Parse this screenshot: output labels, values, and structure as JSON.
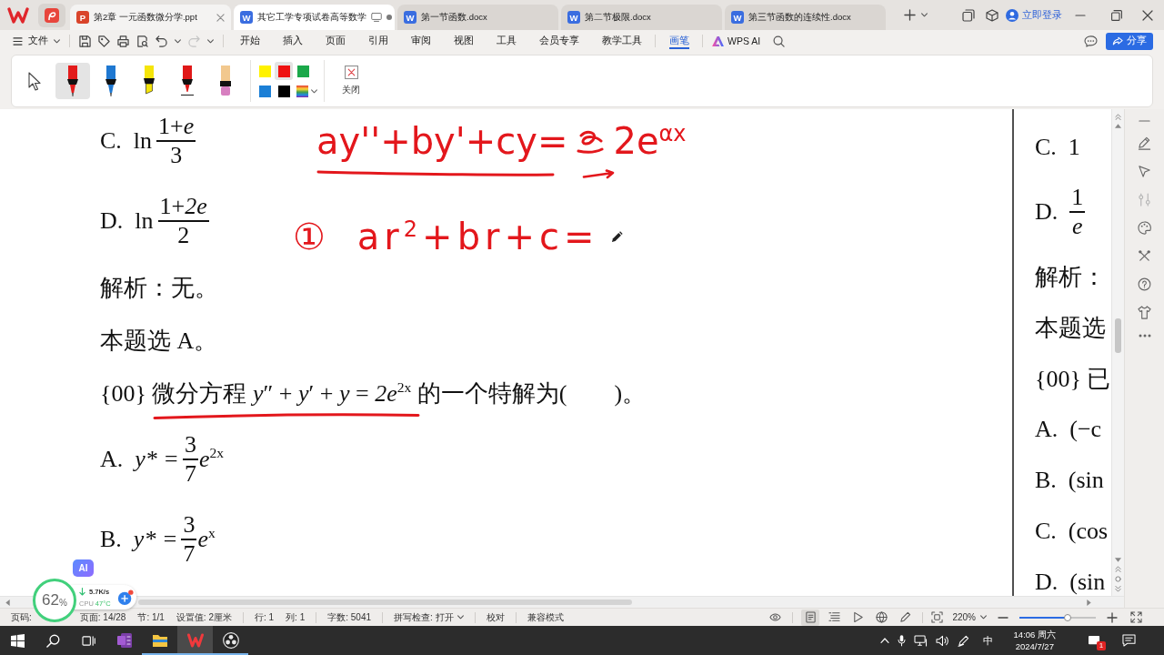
{
  "tab_bar": {
    "tabs": [
      {
        "kind": "ppt",
        "icon_text": "P",
        "title": "第2章 一元函数微分学.ppt",
        "selected": false,
        "hovered": true,
        "modified": false
      },
      {
        "kind": "doc",
        "icon_text": "W",
        "title": "其它工学专项试卷高等数学",
        "selected": true,
        "hovered": false,
        "modified": true
      },
      {
        "kind": "doc",
        "icon_text": "W",
        "title": "第一节函数.docx",
        "selected": false,
        "hovered": false,
        "modified": false
      },
      {
        "kind": "doc",
        "icon_text": "W",
        "title": "第二节极限.docx",
        "selected": false,
        "hovered": false,
        "modified": false
      },
      {
        "kind": "doc",
        "icon_text": "W",
        "title": "第三节函数的连续性.docx",
        "selected": false,
        "hovered": false,
        "modified": false
      }
    ],
    "login": "立即登录"
  },
  "menu_bar": {
    "file_menu": "文件",
    "redo": {
      "disabled": true
    },
    "tab_groups": [
      [
        {
          "kind": "text",
          "label": "开始",
          "selected": false
        },
        {
          "kind": "text",
          "label": "插入",
          "selected": false
        },
        {
          "kind": "text",
          "label": "页面",
          "selected": false
        },
        {
          "kind": "text",
          "label": "引用",
          "selected": false
        },
        {
          "kind": "text",
          "label": "审阅",
          "selected": false
        },
        {
          "kind": "text",
          "label": "视图",
          "selected": false
        },
        {
          "kind": "text",
          "label": "工具",
          "selected": false
        },
        {
          "kind": "text",
          "label": "会员专享",
          "selected": false
        },
        {
          "kind": "text",
          "label": "教学工具",
          "selected": false
        }
      ],
      [
        {
          "kind": "text",
          "label": "画笔",
          "selected": true
        }
      ],
      [
        {
          "kind": "ai",
          "label": "WPS AI",
          "selected": false
        }
      ]
    ],
    "share_button": "分享"
  },
  "pen_toolbar": {
    "tools": [
      {
        "kind": "pointer",
        "selected": false
      },
      {
        "kind": "marker",
        "color": "#e31b1b",
        "selected": true
      },
      {
        "kind": "marker",
        "color": "#1f78d1",
        "selected": false
      },
      {
        "kind": "highlighter",
        "color": "#f5e50a",
        "selected": false
      },
      {
        "kind": "pen",
        "color": "#e01818",
        "selected": false
      },
      {
        "kind": "soft",
        "color": "#f2c88e",
        "selected": false
      }
    ],
    "swatches": [
      {
        "kind": "solid",
        "color": "#fff200",
        "selected": false
      },
      {
        "kind": "solid",
        "color": "#ee1111",
        "selected": true
      },
      {
        "kind": "solid",
        "color": "#1aa84a",
        "selected": false
      },
      {
        "kind": "solid",
        "color": "#1b7fd6",
        "selected": false
      },
      {
        "kind": "solid",
        "color": "#000000",
        "selected": false
      },
      {
        "kind": "spectrum",
        "selected": false
      }
    ],
    "close_label": "关闭"
  },
  "document": {
    "left_page": [
      {
        "kind": "ln_fraction",
        "label": "C.",
        "func": "ln",
        "numerator": "1+*e*",
        "denominator": "3",
        "underlined": false
      },
      {
        "kind": "ln_fraction",
        "label": "D.",
        "func": "ln",
        "numerator": "1+*2e*",
        "denominator": "2",
        "underlined": false
      },
      {
        "kind": "text",
        "text": "解析：无。",
        "underlined": false
      },
      {
        "kind": "text",
        "text": "本题选 A。",
        "underlined": false
      },
      {
        "kind": "text",
        "text": "{00} 微分方程 *y*″ + *y*′ + *y* = *2e*$^{2x}$ 的一个特解为(　　)。",
        "underlined": true
      },
      {
        "kind": "option_fraction",
        "label": "A.",
        "lhs": "y* =",
        "numerator": "3",
        "denominator": "7",
        "tail": "*e*$^{2x}$",
        "underlined": false
      },
      {
        "kind": "option_fraction",
        "label": "B.",
        "lhs": "y* =",
        "numerator": "3",
        "denominator": "7",
        "tail": "*e*$^{x}$",
        "underlined": false
      }
    ],
    "ink_lines": [
      {
        "parts": [
          {
            "kind": "text",
            "text": "ay''+by'+cy="
          },
          {
            "kind": "scribble"
          },
          {
            "kind": "text",
            "text": "2e$^{αx}$"
          }
        ],
        "underlined": true,
        "arrow": true
      },
      {
        "parts": [
          {
            "kind": "text",
            "text": "①"
          },
          {
            "kind": "text",
            "text": "ar$^{2}$+br+c="
          }
        ],
        "underlined": false,
        "arrow": false
      }
    ],
    "right_page": [
      {
        "kind": "option_text",
        "label": "C.",
        "text": "1"
      },
      {
        "kind": "fraction",
        "label": "D.",
        "numerator": "1",
        "denominator": "*e*"
      },
      {
        "kind": "text",
        "text": "解析："
      },
      {
        "kind": "text",
        "text": "本题选"
      },
      {
        "kind": "text",
        "text": "{00} 已"
      },
      {
        "kind": "option_text",
        "label": "A.",
        "text": "(−c"
      },
      {
        "kind": "option_text",
        "label": "B.",
        "text": "(sin"
      },
      {
        "kind": "option_text",
        "label": "C.",
        "text": "(cos"
      },
      {
        "kind": "option_text",
        "label": "D.",
        "text": "(sin"
      }
    ]
  },
  "status_bar": {
    "groups": [
      [
        {
          "text": "页码:",
          "dropdown": false
        },
        {
          "text": "页面: 14/28",
          "dropdown": false
        },
        {
          "text": "节: 1/1",
          "dropdown": false
        },
        {
          "text": "设置值: 2厘米",
          "dropdown": false
        }
      ],
      [
        {
          "text": "行: 1",
          "dropdown": false
        },
        {
          "text": "列: 1",
          "dropdown": false
        }
      ],
      [
        {
          "text": "字数: 5041",
          "dropdown": false
        }
      ],
      [
        {
          "text": "拼写检查: 打开",
          "dropdown": true
        }
      ],
      [
        {
          "text": "校对",
          "dropdown": false
        }
      ],
      [
        {
          "text": "兼容模式",
          "dropdown": false
        }
      ]
    ],
    "view_buttons": [
      {
        "kind": "eye",
        "selected": false
      },
      {
        "kind": "page",
        "selected": true
      },
      {
        "kind": "outline",
        "selected": false
      },
      {
        "kind": "play",
        "selected": false
      },
      {
        "kind": "web",
        "selected": false
      },
      {
        "kind": "pen",
        "selected": false
      }
    ],
    "zoom": {
      "value": "220%",
      "level": 0.63
    }
  },
  "monitor_widget": {
    "percent": "62",
    "unit": "%",
    "speed": "5.7K/s",
    "cpu_label": "CPU",
    "cpu_temp": "47°C",
    "ai_badge": "AI"
  },
  "taskbar": {
    "apps": [
      {
        "kind": "notes",
        "active": false,
        "open": false
      },
      {
        "kind": "folder",
        "active": false,
        "open": true
      },
      {
        "kind": "wps",
        "active": true,
        "open": true
      },
      {
        "kind": "recorder",
        "active": false,
        "open": true
      }
    ],
    "ime": "中",
    "time": "14:06 周六",
    "date": "2024/7/27",
    "notifications": "1"
  }
}
